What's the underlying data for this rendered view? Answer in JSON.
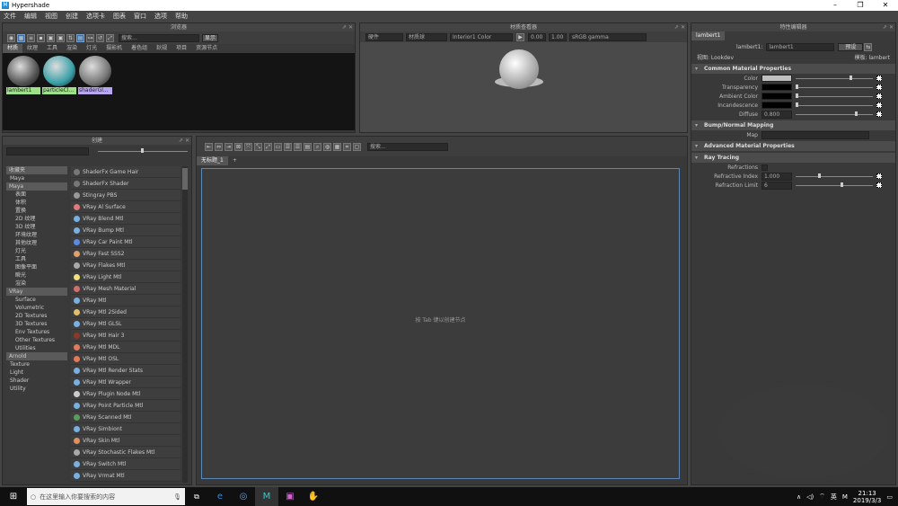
{
  "window": {
    "title": "Hypershade",
    "app_icon": "M",
    "min": "–",
    "max": "❐",
    "close": "✕"
  },
  "menu": [
    "文件",
    "编辑",
    "视图",
    "创建",
    "选项卡",
    "图表",
    "窗口",
    "选项",
    "帮助"
  ],
  "browser": {
    "title": "浏览器",
    "search_placeholder": "搜索...",
    "show_label": "显示",
    "tabs": [
      "材质",
      "纹理",
      "工具",
      "渲染",
      "灯光",
      "摄影机",
      "着色组",
      "鈥规",
      "项目",
      "资源节点"
    ],
    "swatches": [
      {
        "label": "lambert1",
        "ball_color": "#555555",
        "label_bg": "#9fe08a"
      },
      {
        "label": "particleCl...",
        "ball_color": "#3aa0a8",
        "label_bg": "#9fe08a"
      },
      {
        "label": "shaderGl...",
        "ball_color": "#777777",
        "label_bg": "#b8a6f0"
      }
    ]
  },
  "material_viewer": {
    "title": "材质查看器",
    "renderer": "硬件",
    "shape": "材质球",
    "env": "Interior1 Color",
    "exposure": "0.00",
    "gamma": "1.00",
    "colorspace": "sRGB gamma"
  },
  "create_panel": {
    "title": "创建",
    "tree": [
      {
        "label": "收藏夹",
        "kind": "hdr"
      },
      {
        "label": "Maya",
        "kind": "sub"
      },
      {
        "label": "Maya",
        "kind": "hdr"
      },
      {
        "label": "表面",
        "kind": "item"
      },
      {
        "label": "体积",
        "kind": "item"
      },
      {
        "label": "置换",
        "kind": "item"
      },
      {
        "label": "2D 纹理",
        "kind": "item"
      },
      {
        "label": "3D 纹理",
        "kind": "item"
      },
      {
        "label": "环境纹理",
        "kind": "item"
      },
      {
        "label": "其他纹理",
        "kind": "item"
      },
      {
        "label": "灯光",
        "kind": "item"
      },
      {
        "label": "工具",
        "kind": "item"
      },
      {
        "label": "图像平面",
        "kind": "item"
      },
      {
        "label": "瞬光",
        "kind": "item"
      },
      {
        "label": "渲染",
        "kind": "item"
      },
      {
        "label": "VRay",
        "kind": "hdr"
      },
      {
        "label": "Surface",
        "kind": "item"
      },
      {
        "label": "Volumetric",
        "kind": "item"
      },
      {
        "label": "2D Textures",
        "kind": "item"
      },
      {
        "label": "3D Textures",
        "kind": "item"
      },
      {
        "label": "Env Textures",
        "kind": "item"
      },
      {
        "label": "Other Textures",
        "kind": "item"
      },
      {
        "label": "Utilities",
        "kind": "item"
      },
      {
        "label": "Arnold",
        "kind": "hdr"
      },
      {
        "label": "Texture",
        "kind": "sub"
      },
      {
        "label": "Light",
        "kind": "sub"
      },
      {
        "label": "Shader",
        "kind": "sub"
      },
      {
        "label": "Utility",
        "kind": "sub"
      }
    ],
    "nodes": [
      {
        "label": "ShaderFx Game Hair",
        "color": "#777777"
      },
      {
        "label": "ShaderFx Shader",
        "color": "#777777"
      },
      {
        "label": "Stingray PBS",
        "color": "#999999"
      },
      {
        "label": "VRay Al Surface",
        "color": "#e07a7a"
      },
      {
        "label": "VRay Blend Mtl",
        "color": "#7ab0e0"
      },
      {
        "label": "VRay Bump Mtl",
        "color": "#7ab0e0"
      },
      {
        "label": "VRay Car Paint Mtl",
        "color": "#5c8ce0"
      },
      {
        "label": "VRay Fast SSS2",
        "color": "#e0a06a"
      },
      {
        "label": "VRay Flakes Mtl",
        "color": "#aaaaaa"
      },
      {
        "label": "VRay Light Mtl",
        "color": "#f0e080"
      },
      {
        "label": "VRay Mesh Material",
        "color": "#d07070"
      },
      {
        "label": "VRay Mtl",
        "color": "#7ab0e0"
      },
      {
        "label": "VRay Mtl 2Sided",
        "color": "#e0c070"
      },
      {
        "label": "VRay Mtl GLSL",
        "color": "#7ab0e0"
      },
      {
        "label": "VRay Mtl Hair 3",
        "color": "#8a3a2a"
      },
      {
        "label": "VRay Mtl MDL",
        "color": "#e07a5a"
      },
      {
        "label": "VRay Mtl OSL",
        "color": "#e07a5a"
      },
      {
        "label": "VRay Mtl Render Stats",
        "color": "#7ab0e0"
      },
      {
        "label": "VRay Mtl Wrapper",
        "color": "#7ab0e0"
      },
      {
        "label": "VRay Plugin Node Mtl",
        "color": "#cccccc"
      },
      {
        "label": "VRay Point Particle Mtl",
        "color": "#7ab0e0"
      },
      {
        "label": "VRay Scanned Mtl",
        "color": "#5a9a5a"
      },
      {
        "label": "VRay Simbiont",
        "color": "#7ab0e0"
      },
      {
        "label": "VRay Skin Mtl",
        "color": "#e09060"
      },
      {
        "label": "VRay Stochastic Flakes Mtl",
        "color": "#aaaaaa"
      },
      {
        "label": "VRay Switch Mtl",
        "color": "#7ab0e0"
      },
      {
        "label": "VRay Vrmat Mtl",
        "color": "#7ab0e0"
      }
    ]
  },
  "node_editor": {
    "search_placeholder": "搜索...",
    "tab_label": "无标题_1",
    "add_tab": "+",
    "hint": "按 Tab 键以创建节点"
  },
  "attr_editor": {
    "title": "特性编辑器",
    "tab": "lambert1",
    "node_label": "lambert1:",
    "node_value": "lambert1",
    "preset_btn": "预设",
    "view_label": "视图: Lookdev",
    "tag_label": "模板: lambert",
    "sections": [
      {
        "title": "Common Material Properties",
        "rows": [
          {
            "label": "Color",
            "swatch": "#c0c0c0",
            "knob": 0.72
          },
          {
            "label": "Transparency",
            "swatch": "#000000",
            "knob": 0.0
          },
          {
            "label": "Ambient Color",
            "swatch": "#000000",
            "knob": 0.0
          },
          {
            "label": "Incandescence",
            "swatch": "#000000",
            "knob": 0.0
          },
          {
            "label": "Diffuse",
            "value": "0.800",
            "knob": 0.8
          }
        ]
      },
      {
        "title": "Bump/Normal Mapping",
        "rows": [
          {
            "label": "Map",
            "field": ""
          }
        ]
      },
      {
        "title": "Advanced Material Properties",
        "rows": []
      },
      {
        "title": "Ray Tracing",
        "rows": [
          {
            "label": "Refractions",
            "check": true
          },
          {
            "label": "Refractive Index",
            "value": "1.000",
            "knob": 0.3
          },
          {
            "label": "Refraction Limit",
            "value": "6",
            "knob": 0.6
          }
        ]
      }
    ]
  },
  "taskbar": {
    "search_placeholder": "在这里输入你要搜索的内容",
    "time": "21:13",
    "date": "2019/3/3",
    "ime": "M",
    "lang": "英"
  }
}
